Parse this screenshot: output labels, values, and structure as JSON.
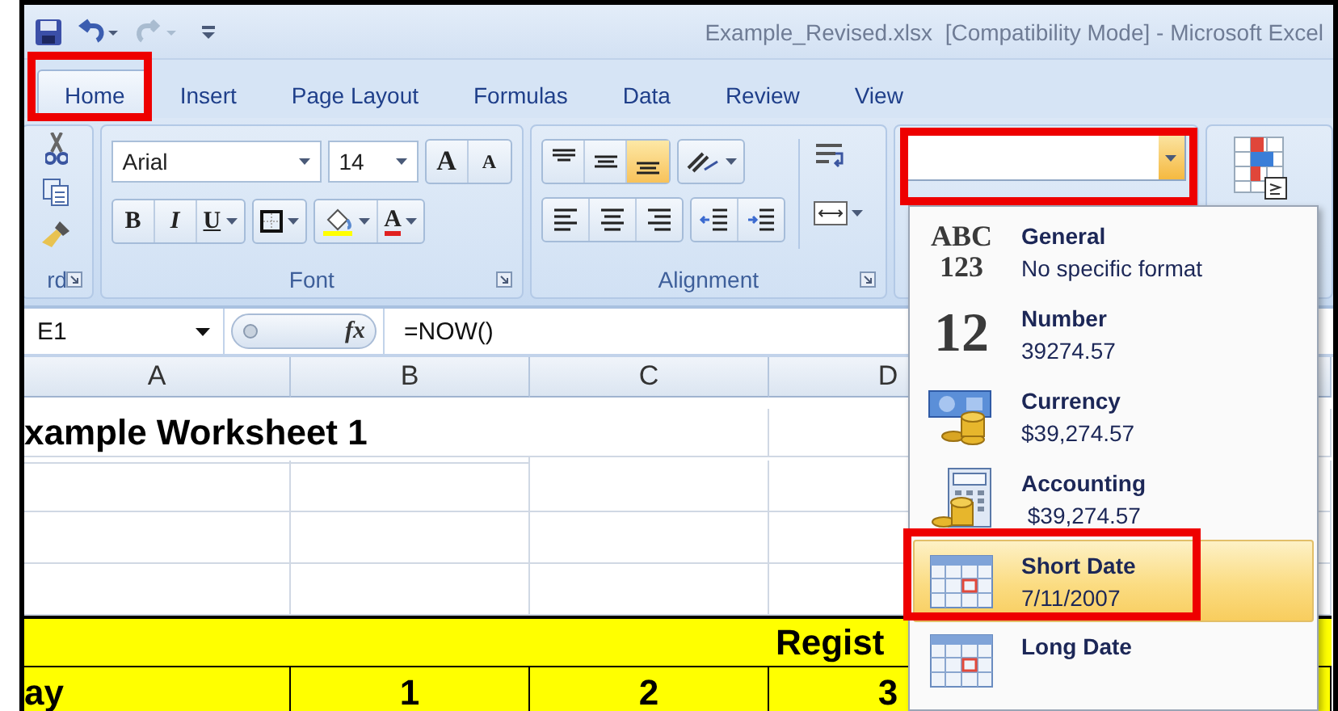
{
  "window": {
    "title": "Example_Revised.xlsx  [Compatibility Mode] - Microsoft Excel"
  },
  "tabs": [
    {
      "label": "Home",
      "selected": true
    },
    {
      "label": "Insert",
      "selected": false
    },
    {
      "label": "Page Layout",
      "selected": false
    },
    {
      "label": "Formulas",
      "selected": false
    },
    {
      "label": "Data",
      "selected": false
    },
    {
      "label": "Review",
      "selected": false
    },
    {
      "label": "View",
      "selected": false
    }
  ],
  "ribbon": {
    "clipboard": {
      "label": "rd"
    },
    "font": {
      "label": "Font",
      "font_name": "Arial",
      "font_size": "14",
      "grow_font": "A",
      "shrink_font": "A",
      "style_buttons": [
        "B",
        "I",
        "U"
      ],
      "font_color": "A"
    },
    "alignment": {
      "label": "Alignment",
      "buttons": [
        {
          "kind": "top",
          "selected": false
        },
        {
          "kind": "middle",
          "selected": false
        },
        {
          "kind": "bottom",
          "selected": true
        }
      ]
    }
  },
  "formula_bar": {
    "name_box": "E1",
    "function_label": "fx",
    "formula": "=NOW()"
  },
  "sheet": {
    "columns": [
      "A",
      "B",
      "C",
      "D"
    ],
    "title_cell": "xample Worksheet 1",
    "banner": "Regist",
    "header_row": [
      "ay",
      "1",
      "2",
      "3"
    ]
  },
  "format_menu": {
    "items": [
      {
        "label": "General",
        "example": "No specific format",
        "kind": "text",
        "icon_lines": [
          "ABC",
          "123"
        ],
        "selected": false
      },
      {
        "label": "Number",
        "example": "39274.57",
        "kind": "text",
        "icon_lines": [
          "12"
        ],
        "selected": false
      },
      {
        "label": "Currency",
        "example": "$39,274.57",
        "kind": "currency",
        "selected": false
      },
      {
        "label": "Accounting",
        "example": " $39,274.57",
        "kind": "accounting",
        "selected": false
      },
      {
        "label": "Short Date",
        "example": "7/11/2007",
        "kind": "date",
        "selected": true
      },
      {
        "label": "Long Date",
        "kind": "date",
        "selected": false
      }
    ]
  }
}
